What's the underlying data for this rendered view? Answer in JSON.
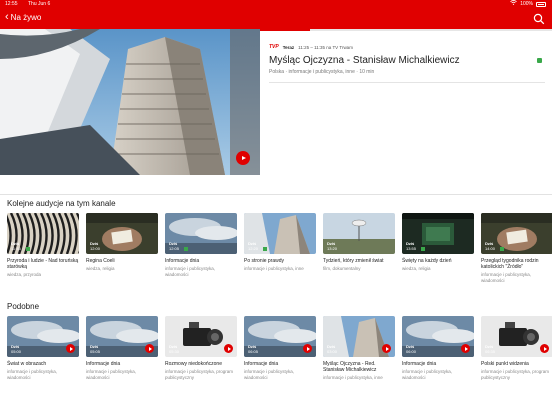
{
  "status": {
    "time": "12:55",
    "date": "Thu Jun 6",
    "battery": "100%"
  },
  "nav": {
    "back_label": "Na żywo"
  },
  "player": {
    "progress": 0.17
  },
  "now": {
    "channel": "TVP",
    "label": "Teraz",
    "time_range": "11:25 – 11:35 na TV Trwam",
    "title": "Myśląc Ojczyzna - Stanisław Michalkiewicz",
    "meta": "Polska · informacje i publicystyka, inne · 10 min"
  },
  "section1": {
    "title": "Kolejne audycje na tym kanale",
    "cards": [
      {
        "day": "Dziś",
        "time": "11:35",
        "title": "Przyroda i ludzie - Nad toruńską starówką",
        "sub": "wiedza, przyroda",
        "theme": "zebra",
        "green": true,
        "play": false
      },
      {
        "day": "Dziś",
        "time": "12:00",
        "title": "Regina Coeli",
        "sub": "wiedza, religia",
        "theme": "hands",
        "green": false,
        "play": false
      },
      {
        "day": "Dziś",
        "time": "12:05",
        "title": "Informacje dnia",
        "sub": "informacje i publicystyka, wiadomości",
        "theme": "sky",
        "green": true,
        "play": false
      },
      {
        "day": "Dziś",
        "time": "12:20",
        "title": "Po stronie prawdy",
        "sub": "informacje i publicystyka, inne",
        "theme": "building",
        "green": true,
        "play": false
      },
      {
        "day": "Dziś",
        "time": "13:20",
        "title": "Tydzień, który zmienił świat",
        "sub": "film, dokumentalny",
        "theme": "dish",
        "green": false,
        "play": false
      },
      {
        "day": "Dziś",
        "time": "13:55",
        "title": "Święty na każdy dzień",
        "sub": "wiedza, religia",
        "theme": "book",
        "green": true,
        "play": false
      },
      {
        "day": "Dziś",
        "time": "14:00",
        "title": "Przegląd tygodnika rodzin katolickich \"Źródło\"",
        "sub": "informacje i publicystyka, wiadomości",
        "theme": "hands",
        "green": true,
        "play": false
      }
    ]
  },
  "section2": {
    "title": "Podobne",
    "cards": [
      {
        "day": "Dziś",
        "time": "05:00",
        "title": "Świat w obrazach",
        "sub": "informacje i publicystyka, wiadomości",
        "theme": "sky",
        "green": false,
        "play": true
      },
      {
        "day": "Dziś",
        "time": "05:05",
        "title": "Informacje dnia",
        "sub": "informacje i publicystyka, wiadomości",
        "theme": "sky",
        "green": false,
        "play": true
      },
      {
        "day": "Dziś",
        "time": "05:30",
        "title": "Rozmowy niedokończone",
        "sub": "informacje i publicystyka, program publicystyczny",
        "theme": "camera",
        "green": false,
        "play": true
      },
      {
        "day": "Dziś",
        "time": "06:05",
        "title": "Informacje dnia",
        "sub": "informacje i publicystyka, wiadomości",
        "theme": "sky",
        "green": false,
        "play": true
      },
      {
        "day": "Dziś",
        "time": "03:00",
        "title": "Myśląc Ojczyzna - Red. Stanisław Michalkiewicz",
        "sub": "informacje i publicystyka, inne",
        "theme": "building",
        "green": false,
        "play": true
      },
      {
        "day": "Dziś",
        "time": "06:00",
        "title": "Informacje dnia",
        "sub": "informacje i publicystyka, wiadomości",
        "theme": "sky",
        "green": false,
        "play": true
      },
      {
        "day": "Dziś",
        "time": "06:35",
        "title": "Polski punkt widzenia",
        "sub": "informacje i publicystyka, program publicystyczny",
        "theme": "camera",
        "green": false,
        "play": true
      }
    ]
  }
}
